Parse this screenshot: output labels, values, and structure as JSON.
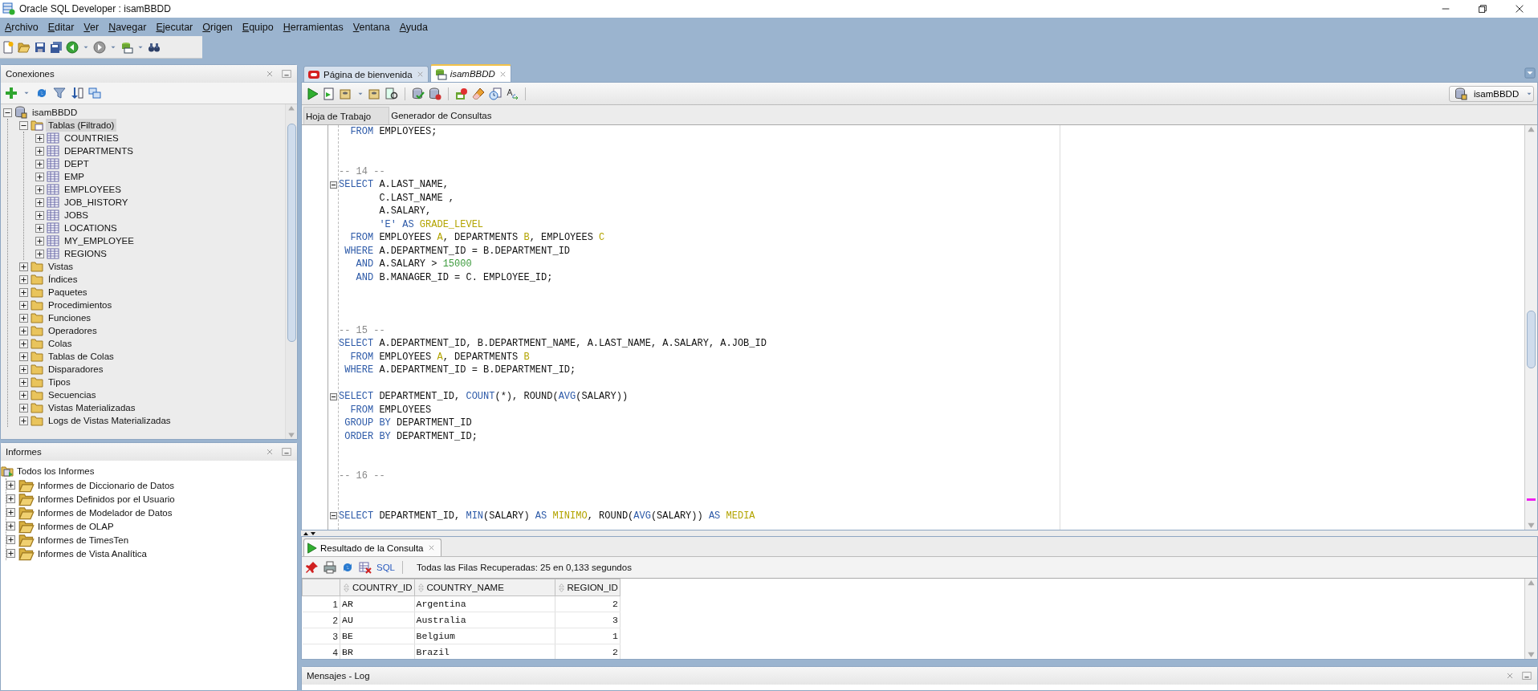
{
  "window": {
    "title": "Oracle SQL Developer : isamBBDD"
  },
  "menu": [
    "Archivo",
    "Editar",
    "Ver",
    "Navegar",
    "Ejecutar",
    "Origen",
    "Equipo",
    "Herramientas",
    "Ventana",
    "Ayuda"
  ],
  "connections": {
    "title": "Conexiones",
    "tree": [
      {
        "label": "isamBBDD",
        "kind": "database",
        "expanded": true,
        "selected": false,
        "children": [
          {
            "label": "Tablas (Filtrado)",
            "kind": "tables-folder",
            "expanded": true,
            "selected": true,
            "children": [
              {
                "label": "COUNTRIES",
                "kind": "table",
                "expanded": false,
                "selected": false
              },
              {
                "label": "DEPARTMENTS",
                "kind": "table",
                "expanded": false,
                "selected": false
              },
              {
                "label": "DEPT",
                "kind": "table",
                "expanded": false,
                "selected": false
              },
              {
                "label": "EMP",
                "kind": "table",
                "expanded": false,
                "selected": false
              },
              {
                "label": "EMPLOYEES",
                "kind": "table",
                "expanded": false,
                "selected": false
              },
              {
                "label": "JOB_HISTORY",
                "kind": "table",
                "expanded": false,
                "selected": false
              },
              {
                "label": "JOBS",
                "kind": "table",
                "expanded": false,
                "selected": false
              },
              {
                "label": "LOCATIONS",
                "kind": "table",
                "expanded": false,
                "selected": false
              },
              {
                "label": "MY_EMPLOYEE",
                "kind": "table",
                "expanded": false,
                "selected": false
              },
              {
                "label": "REGIONS",
                "kind": "table",
                "expanded": false,
                "selected": false
              }
            ]
          },
          {
            "label": "Vistas",
            "kind": "folder",
            "expanded": false,
            "selected": false
          },
          {
            "label": "Índices",
            "kind": "folder",
            "expanded": false,
            "selected": false
          },
          {
            "label": "Paquetes",
            "kind": "folder",
            "expanded": false,
            "selected": false
          },
          {
            "label": "Procedimientos",
            "kind": "folder",
            "expanded": false,
            "selected": false
          },
          {
            "label": "Funciones",
            "kind": "folder",
            "expanded": false,
            "selected": false
          },
          {
            "label": "Operadores",
            "kind": "folder",
            "expanded": false,
            "selected": false
          },
          {
            "label": "Colas",
            "kind": "folder",
            "expanded": false,
            "selected": false
          },
          {
            "label": "Tablas de Colas",
            "kind": "folder",
            "expanded": false,
            "selected": false
          },
          {
            "label": "Disparadores",
            "kind": "folder",
            "expanded": false,
            "selected": false
          },
          {
            "label": "Tipos",
            "kind": "folder",
            "expanded": false,
            "selected": false
          },
          {
            "label": "Secuencias",
            "kind": "folder",
            "expanded": false,
            "selected": false
          },
          {
            "label": "Vistas Materializadas",
            "kind": "folder",
            "expanded": false,
            "selected": false
          },
          {
            "label": "Logs de Vistas Materializadas",
            "kind": "folder",
            "expanded": false,
            "selected": false
          }
        ]
      }
    ]
  },
  "reports": {
    "title": "Informes",
    "root": "Todos los Informes",
    "items": [
      {
        "label": "Informes de Diccionario de Datos",
        "expanded": false
      },
      {
        "label": "Informes Definidos por el Usuario",
        "expanded": false
      },
      {
        "label": "Informes de Modelador de Datos",
        "expanded": false
      },
      {
        "label": "Informes de OLAP",
        "expanded": false
      },
      {
        "label": "Informes de TimesTen",
        "expanded": false
      },
      {
        "label": "Informes de Vista Analítica",
        "expanded": false
      }
    ]
  },
  "document_tabs": [
    {
      "label": "Página de bienvenida",
      "kind": "welcome",
      "selected": false
    },
    {
      "label": "isamBBDD",
      "kind": "worksheet",
      "selected": true
    }
  ],
  "connection_selector": {
    "value": "isamBBDD"
  },
  "editor_tabs": [
    {
      "label": "Hoja de Trabajo",
      "selected": true
    },
    {
      "label": "Generador de Consultas",
      "selected": false
    }
  ],
  "code_lines": [
    {
      "kind": "code",
      "fold_marker": false,
      "segments": [
        {
          "kind": "keyword",
          "text": "  FROM"
        },
        {
          "kind": "plain",
          "text": " EMPLOYEES;"
        }
      ]
    },
    {
      "kind": "blank"
    },
    {
      "kind": "blank"
    },
    {
      "kind": "code",
      "fold_marker": false,
      "segments": [
        {
          "kind": "comment",
          "text": "-- 14 --"
        }
      ]
    },
    {
      "kind": "code",
      "fold_marker": true,
      "segments": [
        {
          "kind": "keyword",
          "text": "SELECT"
        },
        {
          "kind": "plain",
          "text": " A.LAST_NAME,"
        }
      ]
    },
    {
      "kind": "code",
      "fold_marker": false,
      "segments": [
        {
          "kind": "plain",
          "text": "       C.LAST_NAME ,"
        }
      ]
    },
    {
      "kind": "code",
      "fold_marker": false,
      "segments": [
        {
          "kind": "plain",
          "text": "       A.SALARY,"
        }
      ]
    },
    {
      "kind": "code",
      "fold_marker": false,
      "segments": [
        {
          "kind": "string",
          "text": "       'E'"
        },
        {
          "kind": "keyword",
          "text": " AS"
        },
        {
          "kind": "alias",
          "text": " GRADE_LEVEL"
        }
      ]
    },
    {
      "kind": "code",
      "fold_marker": false,
      "segments": [
        {
          "kind": "keyword",
          "text": "  FROM"
        },
        {
          "kind": "plain",
          "text": " EMPLOYEES "
        },
        {
          "kind": "alias",
          "text": "A"
        },
        {
          "kind": "plain",
          "text": ", DEPARTMENTS "
        },
        {
          "kind": "alias",
          "text": "B"
        },
        {
          "kind": "plain",
          "text": ", EMPLOYEES "
        },
        {
          "kind": "alias",
          "text": "C"
        }
      ]
    },
    {
      "kind": "code",
      "fold_marker": false,
      "segments": [
        {
          "kind": "keyword",
          "text": " WHERE"
        },
        {
          "kind": "plain",
          "text": " A.DEPARTMENT_ID = B.DEPARTMENT_ID"
        }
      ]
    },
    {
      "kind": "code",
      "fold_marker": false,
      "segments": [
        {
          "kind": "keyword",
          "text": "   AND"
        },
        {
          "kind": "plain",
          "text": " A.SALARY > "
        },
        {
          "kind": "number",
          "text": "15000"
        }
      ]
    },
    {
      "kind": "code",
      "fold_marker": false,
      "segments": [
        {
          "kind": "keyword",
          "text": "   AND"
        },
        {
          "kind": "plain",
          "text": " B.MANAGER_ID = C. EMPLOYEE_ID;"
        }
      ]
    },
    {
      "kind": "blank"
    },
    {
      "kind": "blank"
    },
    {
      "kind": "blank"
    },
    {
      "kind": "code",
      "fold_marker": false,
      "segments": [
        {
          "kind": "comment",
          "text": "-- 15 --"
        }
      ]
    },
    {
      "kind": "code",
      "fold_marker": false,
      "segments": [
        {
          "kind": "keyword",
          "text": "SELECT"
        },
        {
          "kind": "plain",
          "text": " A.DEPARTMENT_ID, B.DEPARTMENT_NAME, A.LAST_NAME, A.SALARY, A.JOB_ID"
        }
      ]
    },
    {
      "kind": "code",
      "fold_marker": false,
      "segments": [
        {
          "kind": "keyword",
          "text": "  FROM"
        },
        {
          "kind": "plain",
          "text": " EMPLOYEES "
        },
        {
          "kind": "alias",
          "text": "A"
        },
        {
          "kind": "plain",
          "text": ", DEPARTMENTS "
        },
        {
          "kind": "alias",
          "text": "B"
        }
      ]
    },
    {
      "kind": "code",
      "fold_marker": false,
      "segments": [
        {
          "kind": "keyword",
          "text": " WHERE"
        },
        {
          "kind": "plain",
          "text": " A.DEPARTMENT_ID = B.DEPARTMENT_ID;"
        }
      ]
    },
    {
      "kind": "blank"
    },
    {
      "kind": "code",
      "fold_marker": true,
      "segments": [
        {
          "kind": "keyword",
          "text": "SELECT"
        },
        {
          "kind": "plain",
          "text": " DEPARTMENT_ID, "
        },
        {
          "kind": "keyword",
          "text": "COUNT"
        },
        {
          "kind": "plain",
          "text": "(*), ROUND("
        },
        {
          "kind": "keyword",
          "text": "AVG"
        },
        {
          "kind": "plain",
          "text": "(SALARY))"
        }
      ]
    },
    {
      "kind": "code",
      "fold_marker": false,
      "segments": [
        {
          "kind": "keyword",
          "text": "  FROM"
        },
        {
          "kind": "plain",
          "text": " EMPLOYEES"
        }
      ]
    },
    {
      "kind": "code",
      "fold_marker": false,
      "segments": [
        {
          "kind": "keyword",
          "text": " GROUP BY"
        },
        {
          "kind": "plain",
          "text": " DEPARTMENT_ID"
        }
      ]
    },
    {
      "kind": "code",
      "fold_marker": false,
      "segments": [
        {
          "kind": "keyword",
          "text": " ORDER BY"
        },
        {
          "kind": "plain",
          "text": " DEPARTMENT_ID;"
        }
      ]
    },
    {
      "kind": "blank"
    },
    {
      "kind": "blank"
    },
    {
      "kind": "code",
      "fold_marker": false,
      "segments": [
        {
          "kind": "comment",
          "text": "-- 16 --"
        }
      ]
    },
    {
      "kind": "blank"
    },
    {
      "kind": "blank"
    },
    {
      "kind": "code",
      "fold_marker": true,
      "segments": [
        {
          "kind": "keyword",
          "text": "SELECT"
        },
        {
          "kind": "plain",
          "text": " DEPARTMENT_ID, "
        },
        {
          "kind": "keyword",
          "text": "MIN"
        },
        {
          "kind": "plain",
          "text": "(SALARY)"
        },
        {
          "kind": "keyword",
          "text": " AS"
        },
        {
          "kind": "alias",
          "text": " MINIMO"
        },
        {
          "kind": "plain",
          "text": ", ROUND("
        },
        {
          "kind": "keyword",
          "text": "AVG"
        },
        {
          "kind": "plain",
          "text": "(SALARY))"
        },
        {
          "kind": "keyword",
          "text": " AS"
        },
        {
          "kind": "alias",
          "text": " MEDIA"
        }
      ]
    }
  ],
  "results": {
    "tab": "Resultado de la Consulta",
    "sql_link": "SQL",
    "status": "Todas las Filas Recuperadas: 25 en 0,133 segundos",
    "columns": [
      {
        "label": "COUNTRY_ID",
        "kind": "text"
      },
      {
        "label": "COUNTRY_NAME",
        "kind": "text"
      },
      {
        "label": "REGION_ID",
        "kind": "number"
      }
    ],
    "rows": [
      {
        "number": "1",
        "cells": [
          "AR",
          "Argentina",
          "2"
        ]
      },
      {
        "number": "2",
        "cells": [
          "AU",
          "Australia",
          "3"
        ]
      },
      {
        "number": "3",
        "cells": [
          "BE",
          "Belgium",
          "1"
        ]
      },
      {
        "number": "4",
        "cells": [
          "BR",
          "Brazil",
          "2"
        ]
      }
    ]
  },
  "messages": {
    "title": "Mensajes - Log"
  }
}
